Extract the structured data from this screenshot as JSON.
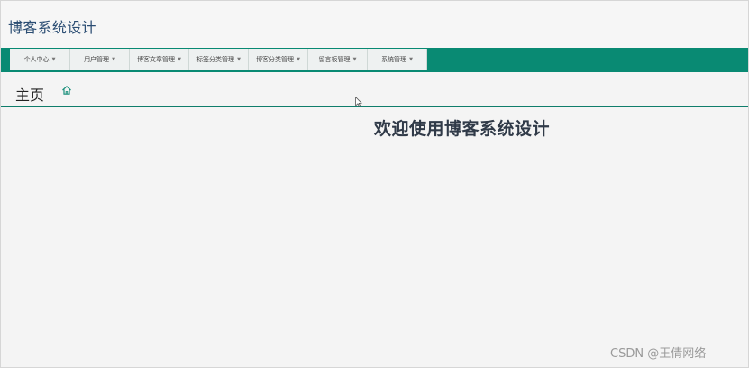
{
  "header": {
    "title": "博客系统设计"
  },
  "nav": {
    "items": [
      {
        "label": "个人中心"
      },
      {
        "label": "用户管理"
      },
      {
        "label": "博客文章管理"
      },
      {
        "label": "标签分类管理"
      },
      {
        "label": "博客分类管理"
      },
      {
        "label": "留言板管理"
      },
      {
        "label": "系统管理"
      }
    ],
    "caret": "▼"
  },
  "breadcrumb": {
    "title": "主页",
    "icon": "home-icon"
  },
  "main": {
    "welcome": "欢迎使用博客系统设计"
  },
  "watermark": "CSDN @王倩网络",
  "colors": {
    "nav_background": "#098a73",
    "nav_item_background": "#eef1f1",
    "title_color": "#2b4d73",
    "accent_line": "#0f7d6b",
    "page_background": "#f4f4f4"
  }
}
